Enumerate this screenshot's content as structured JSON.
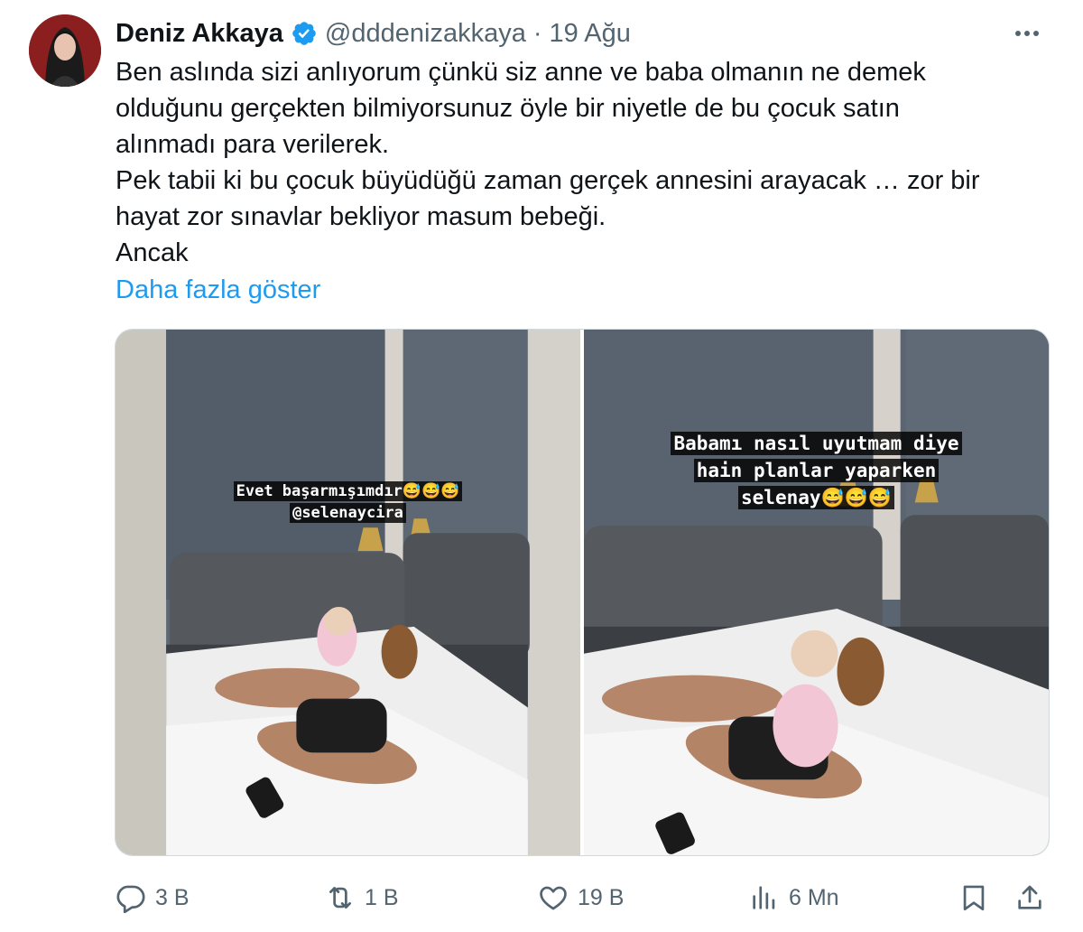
{
  "tweet": {
    "author_name": "Deniz Akkaya",
    "handle": "@dddenizakkaya",
    "separator": "·",
    "date": "19 Ağu",
    "text_lines": [
      "Ben aslında sizi anlıyorum çünkü siz anne ve baba olmanın ne demek",
      "olduğunu gerçekten bilmiyorsunuz öyle bir niyetle de bu çocuk satın",
      "alınmadı para verilerek.",
      "Pek tabii ki bu çocuk büyüdüğü zaman gerçek annesini arayacak … zor bir",
      "hayat zor sınavlar bekliyor masum bebeği.",
      "Ancak"
    ],
    "show_more": "Daha fazla göster"
  },
  "media": [
    {
      "caption_lines": [
        "Evet başarmışımdır😅😅😅",
        "@selenaycira"
      ]
    },
    {
      "caption_lines": [
        "Babamı nasıl uyutmam diye",
        "hain planlar yaparken",
        "selenay😅😅😅"
      ]
    }
  ],
  "actions": {
    "replies": "3 B",
    "reposts": "1 B",
    "likes": "19 B",
    "views": "6 Mn"
  },
  "colors": {
    "text": "#0f1419",
    "secondary": "#536471",
    "link": "#1d9bf0",
    "verified": "#1d9bf0",
    "border": "#cfd9de"
  },
  "icons": [
    "verified-badge-icon",
    "more-icon",
    "reply-icon",
    "repost-icon",
    "like-icon",
    "views-icon",
    "bookmark-icon",
    "share-icon"
  ]
}
